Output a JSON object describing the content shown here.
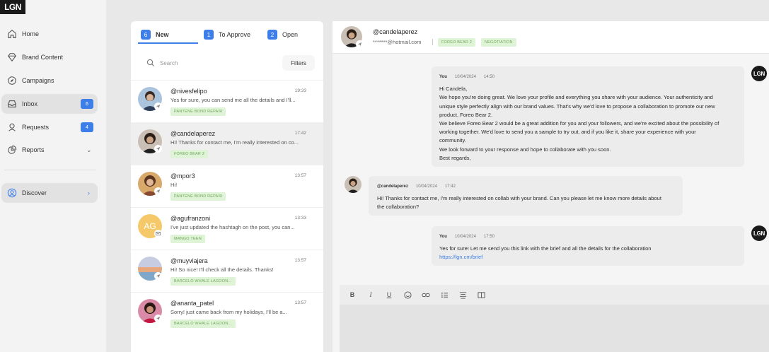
{
  "app": {
    "logo": "LGN"
  },
  "sidebar": {
    "items": [
      {
        "label": "Home",
        "icon": "home-icon"
      },
      {
        "label": "Brand Content",
        "icon": "diamond-icon"
      },
      {
        "label": "Campaigns",
        "icon": "compass-icon"
      },
      {
        "label": "Inbox",
        "icon": "inbox-icon",
        "badge": "6",
        "active": true
      },
      {
        "label": "Requests",
        "icon": "person-icon",
        "badge": "4"
      },
      {
        "label": "Reports",
        "icon": "pie-chart-icon"
      }
    ],
    "discover": {
      "label": "Discover",
      "icon": "user-circle-icon"
    }
  },
  "inbox": {
    "tabs": [
      {
        "count": "6",
        "label": "New",
        "active": true
      },
      {
        "count": "1",
        "label": "To Approve"
      },
      {
        "count": "2",
        "label": "Open"
      }
    ],
    "search_placeholder": "Search",
    "filters_label": "Filters",
    "conversations": [
      {
        "user": "@nivesfelipo",
        "time": "19:33",
        "preview": "Yes for sure, you can send me all the details and I'll...",
        "tag": "PANTENE BOND REPAIR"
      },
      {
        "user": "@candelaperez",
        "time": "17:42",
        "preview": "Hi! Thanks for contact me, I'm really interested on co...",
        "tag": "FOREO BEAR 2",
        "selected": true
      },
      {
        "user": "@mpor3",
        "time": "13:57",
        "preview": "Hi!",
        "tag": "PANTENE BOND REPAIR"
      },
      {
        "user": "@agufranzoni",
        "time": "13:33",
        "preview": "I've just updated the hashtagh on the post, you can...",
        "tag": "MANGO TEEN",
        "initials": "AG"
      },
      {
        "user": "@muyviajera",
        "time": "13:57",
        "preview": "Hi! So nice! I'll check all the details. Thanks!",
        "tag": "BARCELO WHALE LAGOON..."
      },
      {
        "user": "@ananta_patel",
        "time": "13:57",
        "preview": "Sorry! just came back from my holidays, I'll be a...",
        "tag": "BARCELO WHALE LAGOON..."
      }
    ]
  },
  "chat": {
    "header": {
      "user": "@candelaperez",
      "email": "*******@hotmail.com",
      "separator": "|",
      "tags": [
        "FOREO BEAR 2",
        "NEGOTIATION"
      ]
    },
    "messages": [
      {
        "sender": "You",
        "date": "10/04/2024",
        "time": "14:50",
        "avatar": "LGN",
        "lines": [
          "Hi Candela,",
          "We hope you're doing great. We love your profile and everything you share with your audience. Your authenticity and",
          "unique style perfectly align with our brand values. That's why we'd love to propose a collaboration to promote our new",
          "product, Foreo Bear 2.",
          "We believe Foreo Bear 2 would be a great addition for you and your followers, and we're excited about the possibility of",
          "working together. We'd love to send you a sample to try out, and if you like it, share your experience with your",
          "community.",
          "We look forward to your response and hope to collaborate with you soon.",
          "Best regards,"
        ]
      },
      {
        "sender": "@candelaperez",
        "date": "10/04/2024",
        "time": "17:42",
        "lines": [
          "Hi! Thanks for contact me, I'm really interested on collab with your brand. Can you please let me know more details about",
          "the collaboration?"
        ]
      },
      {
        "sender": "You",
        "date": "10/04/2024",
        "time": "17:50",
        "avatar": "LGN",
        "lines": [
          "Yes for sure! Let me send you this link with the brief and all the details for the collaboration"
        ],
        "link": "https://lgn.cm/brief"
      }
    ]
  },
  "composer": {
    "tools": [
      "B",
      "I",
      "U"
    ]
  },
  "colors": {
    "accent": "#3d7ee8",
    "tag_bg": "#dff3d6",
    "tag_text": "#6fa85a"
  }
}
